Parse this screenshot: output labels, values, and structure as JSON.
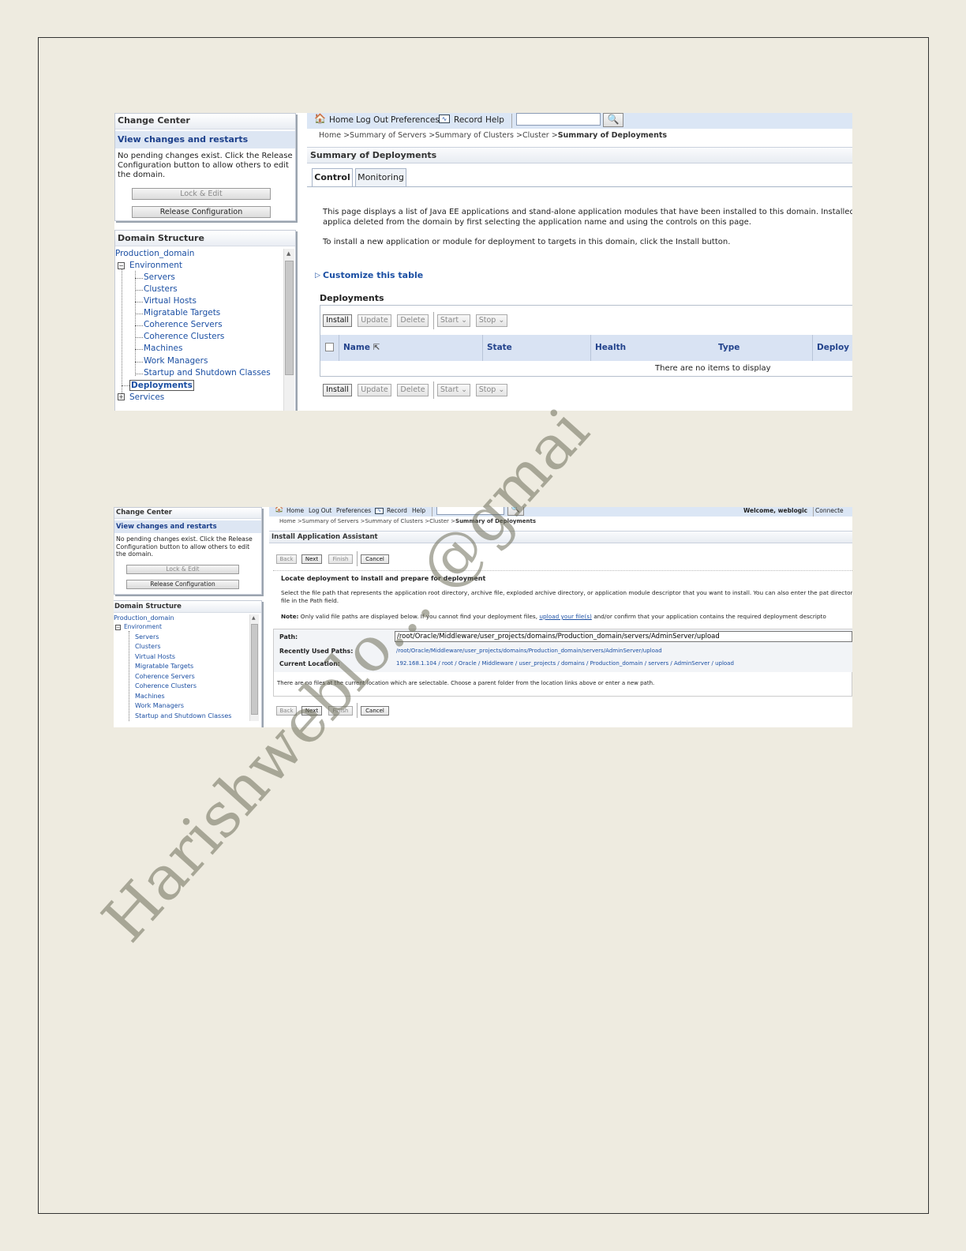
{
  "shot1": {
    "change_center": {
      "title": "Change Center",
      "subtitle": "View changes and restarts",
      "message": "No pending changes exist. Click the Release Configuration button to allow others to edit the domain.",
      "lock_edit": "Lock & Edit",
      "release_config": "Release Configuration"
    },
    "domain_structure": {
      "title": "Domain Structure",
      "items": [
        "Production_domain",
        "Environment",
        "Servers",
        "Clusters",
        "Virtual Hosts",
        "Migratable Targets",
        "Coherence Servers",
        "Coherence Clusters",
        "Machines",
        "Work Managers",
        "Startup and Shutdown Classes",
        "Deployments",
        "Services"
      ]
    },
    "topnav": {
      "home": "Home",
      "logout": "Log Out",
      "preferences": "Preferences",
      "record": "Record",
      "help": "Help"
    },
    "breadcrumb": {
      "trail": "Home >Summary of Servers >Summary of Clusters >Cluster >",
      "current": "Summary of Deployments"
    },
    "section_title": "Summary of Deployments",
    "tabs": [
      "Control",
      "Monitoring"
    ],
    "intro": "This page displays a list of Java EE applications and stand-alone application modules that have been installed to this domain. Installed applica deleted from the domain by first selecting the application name and using the controls on this page.",
    "install_hint": "To install a new application or module for deployment to targets in this domain, click the Install button.",
    "customize": "Customize this table",
    "deployments_title": "Deployments",
    "buttons": {
      "install": "Install",
      "update": "Update",
      "delete": "Delete",
      "start": "Start",
      "stop": "Stop"
    },
    "columns": [
      "Name",
      "State",
      "Health",
      "Type",
      "Deploy"
    ],
    "empty_message": "There are no items to display"
  },
  "shot2": {
    "change_center": {
      "title": "Change Center",
      "subtitle": "View changes and restarts",
      "message": "No pending changes exist. Click the Release Configuration button to allow others to edit the domain.",
      "lock_edit": "Lock & Edit",
      "release_config": "Release Configuration"
    },
    "domain_structure": {
      "title": "Domain Structure",
      "items": [
        "Production_domain",
        "Environment",
        "Servers",
        "Clusters",
        "Virtual Hosts",
        "Migratable Targets",
        "Coherence Servers",
        "Coherence Clusters",
        "Machines",
        "Work Managers",
        "Startup and Shutdown Classes"
      ]
    },
    "topnav": {
      "home": "Home",
      "logout": "Log Out",
      "preferences": "Preferences",
      "record": "Record",
      "help": "Help",
      "welcome": "Welcome, weblogic",
      "connected": "Connecte"
    },
    "breadcrumb": {
      "trail": "Home >Summary of Servers >Summary of Clusters >Cluster >",
      "current": "Summary of Deployments"
    },
    "section_title": "Install Application Assistant",
    "buttons": {
      "back": "Back",
      "next": "Next",
      "finish": "Finish",
      "cancel": "Cancel"
    },
    "heading": "Locate deployment to install and prepare for deployment",
    "desc": "Select the file path that represents the application root directory, archive file, exploded archive directory, or application module descriptor that you want to install. You can also enter the pat directory or file in the Path field.",
    "note_label": "Note:",
    "note_text": " Only valid file paths are displayed below. If you cannot find your deployment files, ",
    "note_link": "upload your file(s)",
    "note_tail": " and/or confirm that your application contains the required deployment descripto",
    "path_label": "Path:",
    "path_value": "/root/Oracle/Middleware/user_projects/domains/Production_domain/servers/AdminServer/upload",
    "recent_label": "Recently Used Paths:",
    "recent_value": "/root/Oracle/Middleware/user_projects/domains/Production_domain/servers/AdminServer/upload",
    "current_label": "Current Location:",
    "current_value": "192.168.1.104 / root / Oracle / Middleware / user_projects / domains / Production_domain / servers / AdminServer / upload",
    "no_files": "There are no files at the current location which are selectable. Choose a parent folder from the location links above or enter a new path."
  },
  "watermark": "Harishweblo... @gmai"
}
